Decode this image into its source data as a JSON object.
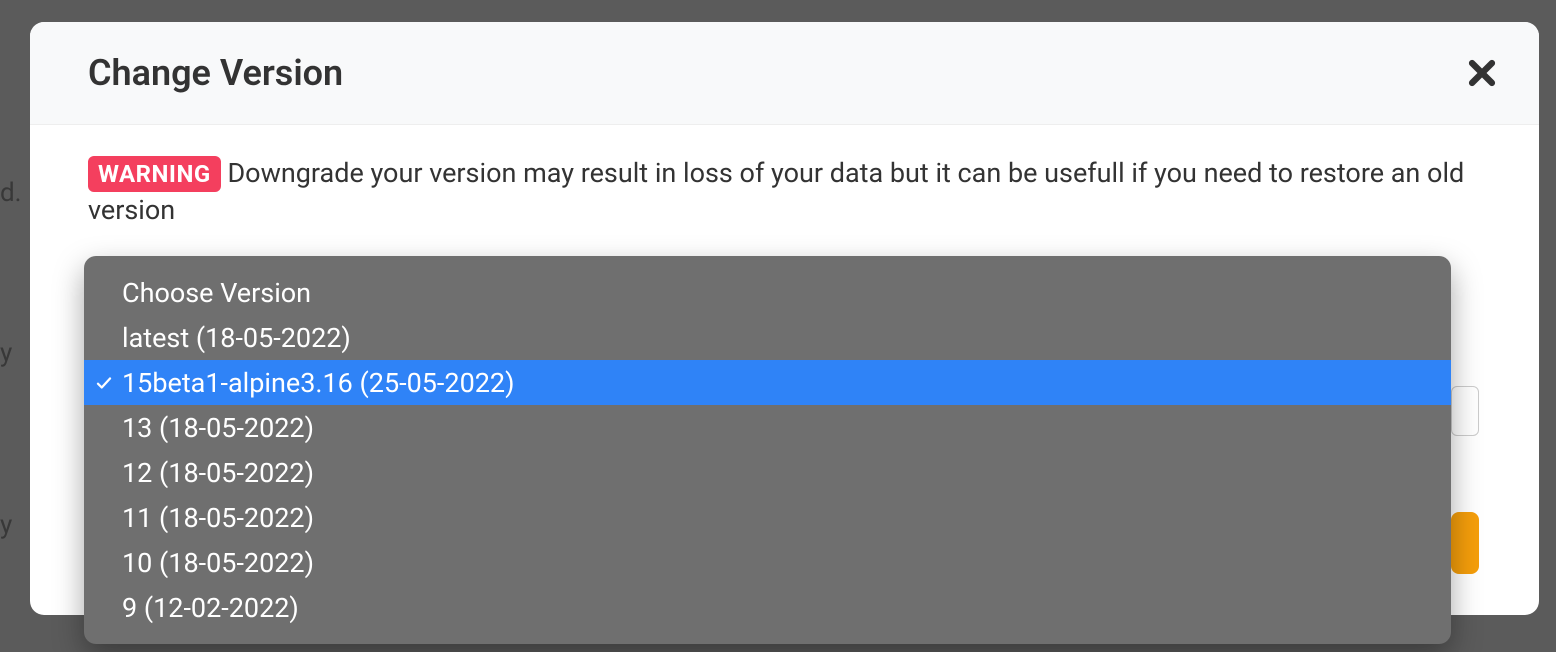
{
  "modal": {
    "title": "Change Version",
    "close_label": "Close"
  },
  "warning": {
    "badge": "WARNING",
    "text": "Downgrade your version may result in loss of your data but it can be usefull if you need to restore an old version"
  },
  "dropdown": {
    "header": "Choose Version",
    "selected_index": 1,
    "options": [
      {
        "label": "latest (18-05-2022)"
      },
      {
        "label": "15beta1-alpine3.16 (25-05-2022)"
      },
      {
        "label": "13 (18-05-2022)"
      },
      {
        "label": "12 (18-05-2022)"
      },
      {
        "label": "11 (18-05-2022)"
      },
      {
        "label": "10 (18-05-2022)"
      },
      {
        "label": "9 (12-02-2022)"
      }
    ]
  },
  "backdrop": {
    "text_d": "d.",
    "text_y1": "y",
    "text_y2": "y"
  }
}
